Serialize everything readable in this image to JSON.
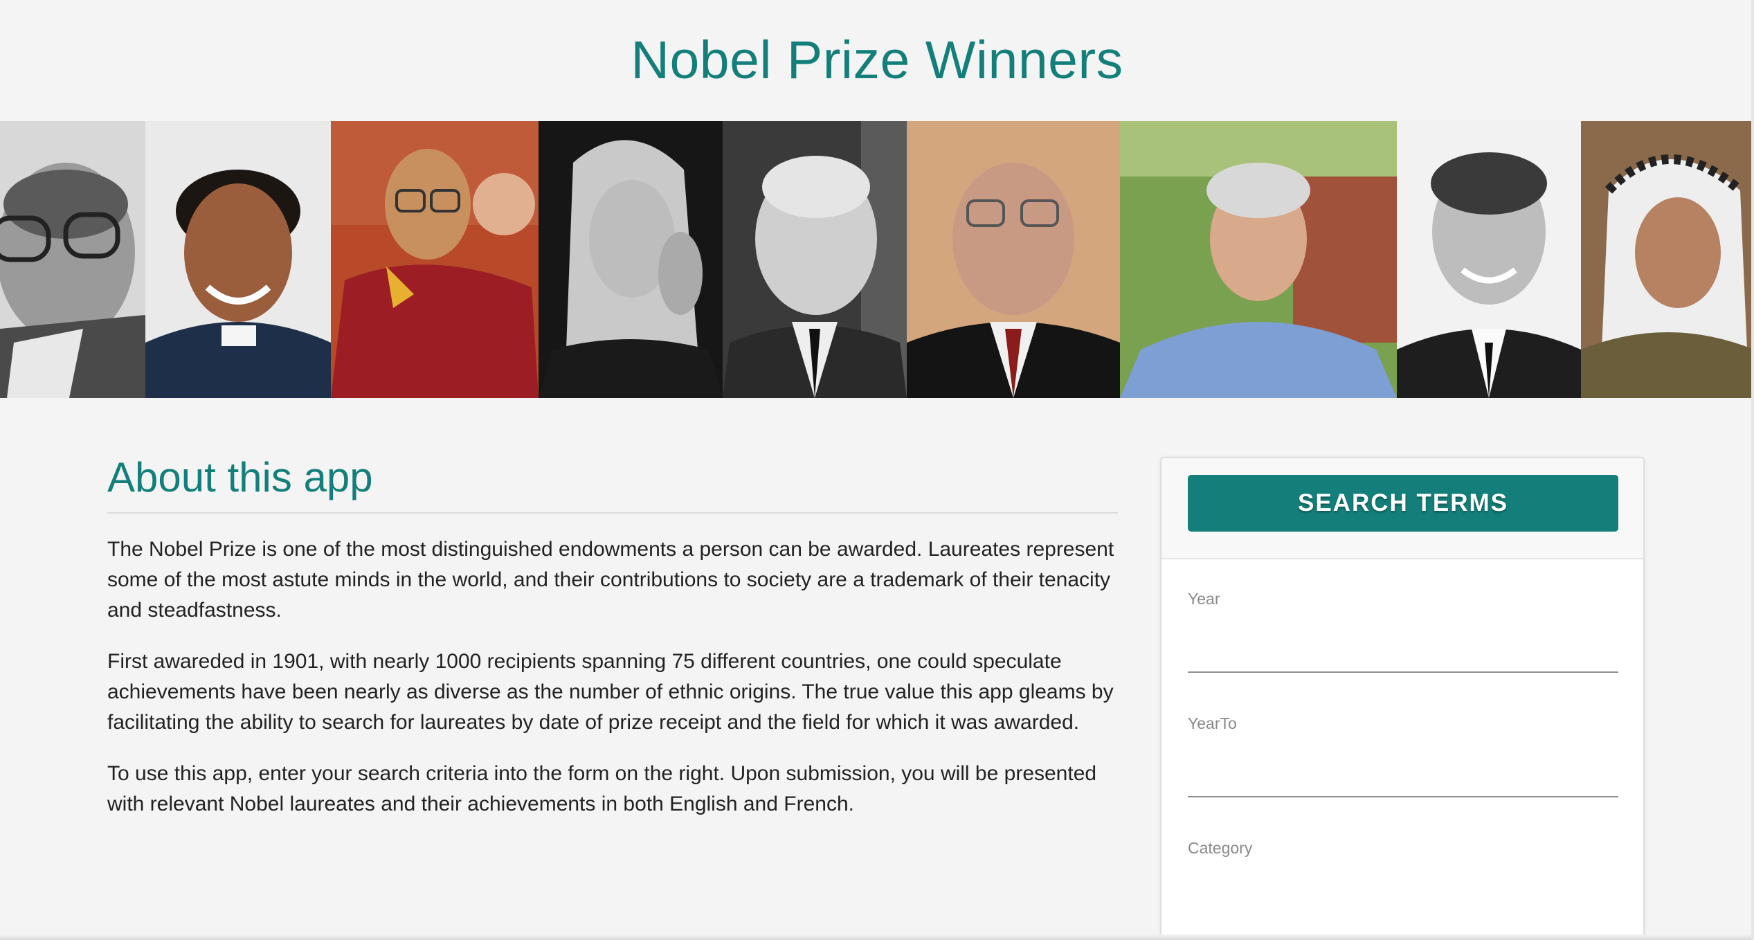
{
  "header": {
    "title": "Nobel Prize Winners"
  },
  "banner": {
    "portraits": [
      {
        "icon": "laureate-portrait",
        "style": "grayscale"
      },
      {
        "icon": "laureate-portrait",
        "style": "color"
      },
      {
        "icon": "laureate-portrait",
        "style": "color"
      },
      {
        "icon": "laureate-portrait",
        "style": "grayscale"
      },
      {
        "icon": "laureate-portrait",
        "style": "grayscale"
      },
      {
        "icon": "laureate-portrait",
        "style": "color"
      },
      {
        "icon": "laureate-portrait",
        "style": "color"
      },
      {
        "icon": "laureate-portrait",
        "style": "grayscale"
      },
      {
        "icon": "laureate-portrait",
        "style": "color"
      }
    ]
  },
  "about": {
    "title": "About this app",
    "paragraphs": [
      "The Nobel Prize is one of the most distinguished endowments a person can be awarded. Laureates represent some of the most astute minds in the world, and their contributions to society are a trademark of their tenacity and steadfastness.",
      "First awareded in 1901, with nearly 1000 recipients spanning 75 different countries, one could speculate achievements have been nearly as diverse as the number of ethnic origins. The true value this app gleams by facilitating the ability to search for laureates by date of prize receipt and the field for which it was awarded.",
      "To use this app, enter your search criteria into the form on the right. Upon submission, you will be presented with relevant Nobel laureates and their achievements in both English and French."
    ]
  },
  "search": {
    "button_label": "SEARCH TERMS",
    "fields": [
      {
        "label": "Year",
        "value": ""
      },
      {
        "label": "YearTo",
        "value": ""
      },
      {
        "label": "Category",
        "value": ""
      }
    ]
  },
  "colors": {
    "accent": "#147f7a",
    "background": "#f4f4f4"
  }
}
